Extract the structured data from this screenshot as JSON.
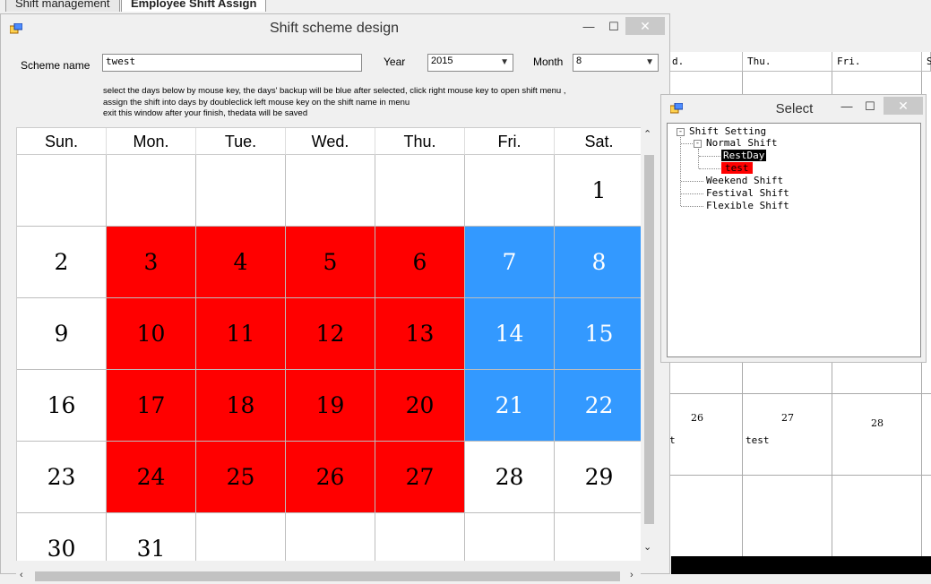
{
  "background": {
    "tabs": [
      "Shift management",
      "Employee Shift Assign"
    ],
    "grid_headers": [
      "d.",
      "Thu.",
      "Fri.",
      "S"
    ],
    "cells": [
      {
        "day": "26",
        "shift": "t"
      },
      {
        "day": "27",
        "shift": "test"
      },
      {
        "day": "28",
        "shift": ""
      }
    ]
  },
  "main_window": {
    "title": "Shift scheme design",
    "scheme_label": "Scheme name",
    "scheme_value": "twest",
    "year_label": "Year",
    "year_value": "2015",
    "month_label": "Month",
    "month_value": "8",
    "instructions": [
      "select the days below by mouse key, the days' backup will be blue after selected,  click right mouse key to open shift menu ,",
      " assign  the shift into days by doubleclick left  mouse key on the shift name in menu",
      "exit this window after your  finish, thedata will be saved"
    ],
    "weekdays": [
      "Sun.",
      "Mon.",
      "Tue.",
      "Wed.",
      "Thu.",
      "Fri.",
      "Sat."
    ],
    "weeks": [
      [
        {
          "d": "",
          "s": ""
        },
        {
          "d": "",
          "s": ""
        },
        {
          "d": "",
          "s": ""
        },
        {
          "d": "",
          "s": ""
        },
        {
          "d": "",
          "s": ""
        },
        {
          "d": "",
          "s": ""
        },
        {
          "d": "1",
          "s": ""
        }
      ],
      [
        {
          "d": "2",
          "s": ""
        },
        {
          "d": "3",
          "s": "red"
        },
        {
          "d": "4",
          "s": "red"
        },
        {
          "d": "5",
          "s": "red"
        },
        {
          "d": "6",
          "s": "red"
        },
        {
          "d": "7",
          "s": "blue"
        },
        {
          "d": "8",
          "s": "blue"
        }
      ],
      [
        {
          "d": "9",
          "s": ""
        },
        {
          "d": "10",
          "s": "red"
        },
        {
          "d": "11",
          "s": "red"
        },
        {
          "d": "12",
          "s": "red"
        },
        {
          "d": "13",
          "s": "red"
        },
        {
          "d": "14",
          "s": "blue"
        },
        {
          "d": "15",
          "s": "blue"
        }
      ],
      [
        {
          "d": "16",
          "s": ""
        },
        {
          "d": "17",
          "s": "red"
        },
        {
          "d": "18",
          "s": "red"
        },
        {
          "d": "19",
          "s": "red"
        },
        {
          "d": "20",
          "s": "red"
        },
        {
          "d": "21",
          "s": "blue"
        },
        {
          "d": "22",
          "s": "blue"
        }
      ],
      [
        {
          "d": "23",
          "s": ""
        },
        {
          "d": "24",
          "s": "red"
        },
        {
          "d": "25",
          "s": "red"
        },
        {
          "d": "26",
          "s": "red"
        },
        {
          "d": "27",
          "s": "red"
        },
        {
          "d": "28",
          "s": ""
        },
        {
          "d": "29",
          "s": ""
        }
      ],
      [
        {
          "d": "30",
          "s": ""
        },
        {
          "d": "31",
          "s": ""
        },
        {
          "d": "",
          "s": ""
        },
        {
          "d": "",
          "s": ""
        },
        {
          "d": "",
          "s": ""
        },
        {
          "d": "",
          "s": ""
        },
        {
          "d": "",
          "s": ""
        }
      ]
    ],
    "colors": {
      "red": "#ff0000",
      "blue": "#3399ff"
    }
  },
  "select_window": {
    "title": "Select",
    "tree": {
      "root": "Shift Setting",
      "normal": "Normal Shift",
      "restday": "RestDay",
      "test": "test",
      "weekend": "Weekend Shift",
      "festival": "Festival Shift",
      "flexible": "Flexible Shift"
    }
  },
  "icons": {
    "minimize": "minimize-icon",
    "maximize": "maximize-icon",
    "close": "close-icon",
    "app": "window-app-icon"
  }
}
